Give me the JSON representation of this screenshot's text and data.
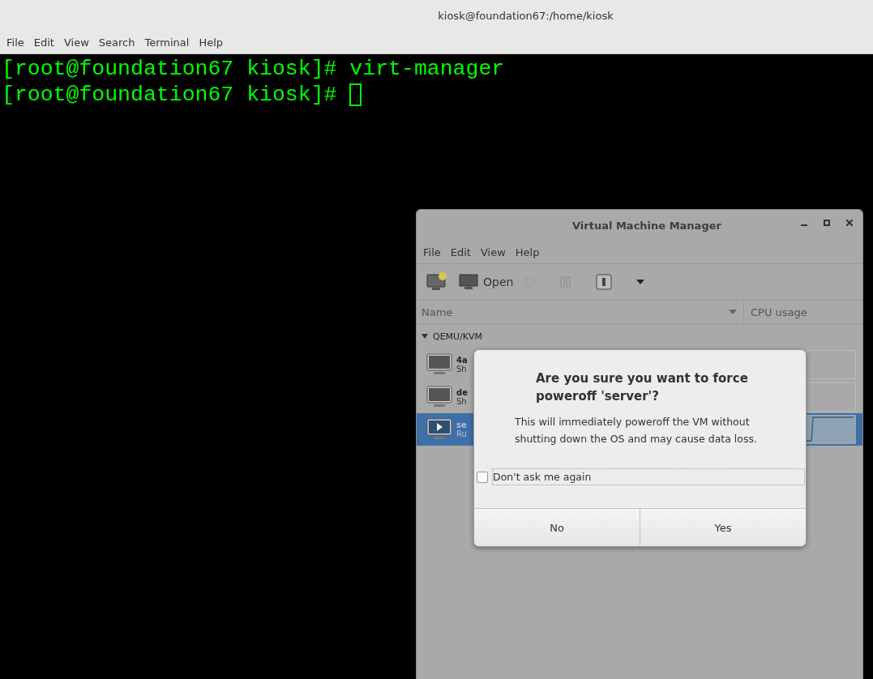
{
  "terminal": {
    "title": "kiosk@foundation67:/home/kiosk",
    "menu": [
      "File",
      "Edit",
      "View",
      "Search",
      "Terminal",
      "Help"
    ],
    "lines": [
      {
        "text": "[root@foundation67 kiosk]# virt-manager",
        "cursor": false
      },
      {
        "text": "[root@foundation67 kiosk]# ",
        "cursor": true
      }
    ]
  },
  "vm_window": {
    "title": "Virtual Machine Manager",
    "menu": [
      "File",
      "Edit",
      "View",
      "Help"
    ],
    "toolbar": {
      "open_label": "Open"
    },
    "columns": [
      "Name",
      "CPU usage"
    ],
    "group": {
      "label": "QEMU/KVM",
      "expanded": true
    },
    "rows": [
      {
        "name": "4a",
        "status": "Sh",
        "running": false,
        "selected": false
      },
      {
        "name": "de",
        "status": "Sh",
        "running": false,
        "selected": false
      },
      {
        "name": "se",
        "status": "Ru",
        "running": true,
        "selected": true
      }
    ]
  },
  "dialog": {
    "title": "Are you sure you want to force poweroff 'server'?",
    "message": "This will immediately poweroff the VM without shutting down the OS and may cause data loss.",
    "checkbox": {
      "label": "Don't ask me again",
      "checked": false
    },
    "buttons": [
      "No",
      "Yes"
    ]
  }
}
